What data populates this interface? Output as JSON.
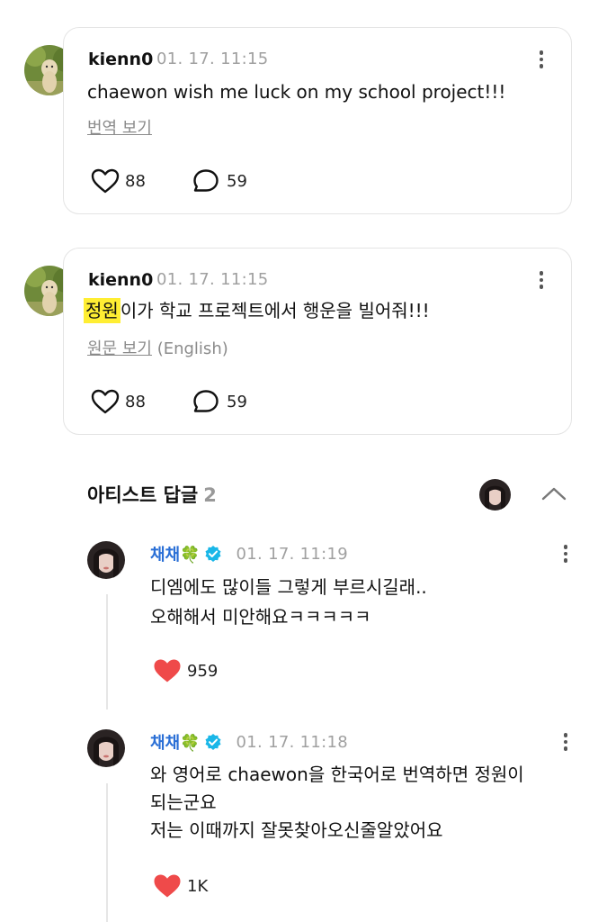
{
  "comments": [
    {
      "username": "kienn0",
      "timestamp": "01. 17. 11:15",
      "text": "chaewon wish me luck on my school project!!!",
      "translate_link": "번역 보기",
      "likes": "88",
      "replies": "59"
    },
    {
      "username": "kienn0",
      "timestamp": "01. 17. 11:15",
      "text_highlight": "정원",
      "text_rest": "이가 학교 프로젝트에서 행운을 빌어줘!!!",
      "original_link": "원문 보기",
      "original_lang": "(English)",
      "likes": "88",
      "replies": "59"
    }
  ],
  "artist_replies": {
    "title": "아티스트 답글",
    "count": "2",
    "items": [
      {
        "username": "채채🍀",
        "timestamp": "01. 17. 11:19",
        "text": "디엠에도 많이들 그렇게 부르시길래..\n오해해서 미안해요ㅋㅋㅋㅋㅋ",
        "likes": "959"
      },
      {
        "username": "채채🍀",
        "timestamp": "01. 17. 11:18",
        "text": "와 영어로 chaewon을 한국어로 번역하면 정원이\n되는군요\n저는 이때까지 잘못찾아오신줄알았어요",
        "likes": "1K"
      }
    ]
  },
  "colors": {
    "verified": "#1ab7e8",
    "artist_name": "#2a6fd6",
    "heart": "#ef4a4a",
    "highlight": "#ffee33"
  }
}
